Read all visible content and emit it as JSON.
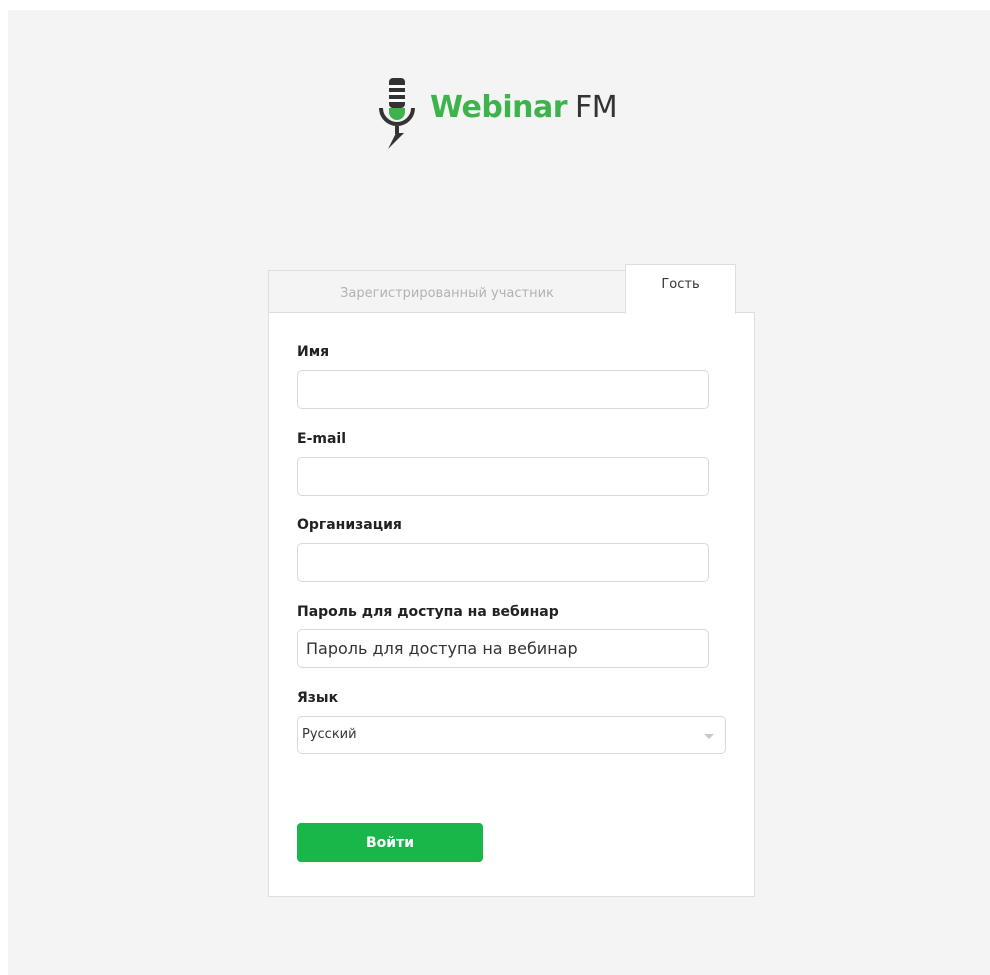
{
  "logo": {
    "icon": "microphone-icon",
    "brand_primary": "Webinar",
    "brand_secondary": "FM",
    "brand_color": "#3cb44b"
  },
  "tabs": [
    {
      "label": "Зарегистрированный участник",
      "active": false
    },
    {
      "label": "Гость",
      "active": true
    }
  ],
  "form": {
    "name_label": "Имя",
    "name_value": "",
    "email_label": "E-mail",
    "email_value": "",
    "organization_label": "Организация",
    "organization_value": "",
    "password_label": "Пароль для доступа на вебинар",
    "password_placeholder": "Пароль для доступа на вебинар",
    "language_label": "Язык",
    "language_selected": "Русский",
    "submit_label": "Войти"
  },
  "colors": {
    "accent": "#19b64a",
    "background": "#f4f4f4"
  }
}
